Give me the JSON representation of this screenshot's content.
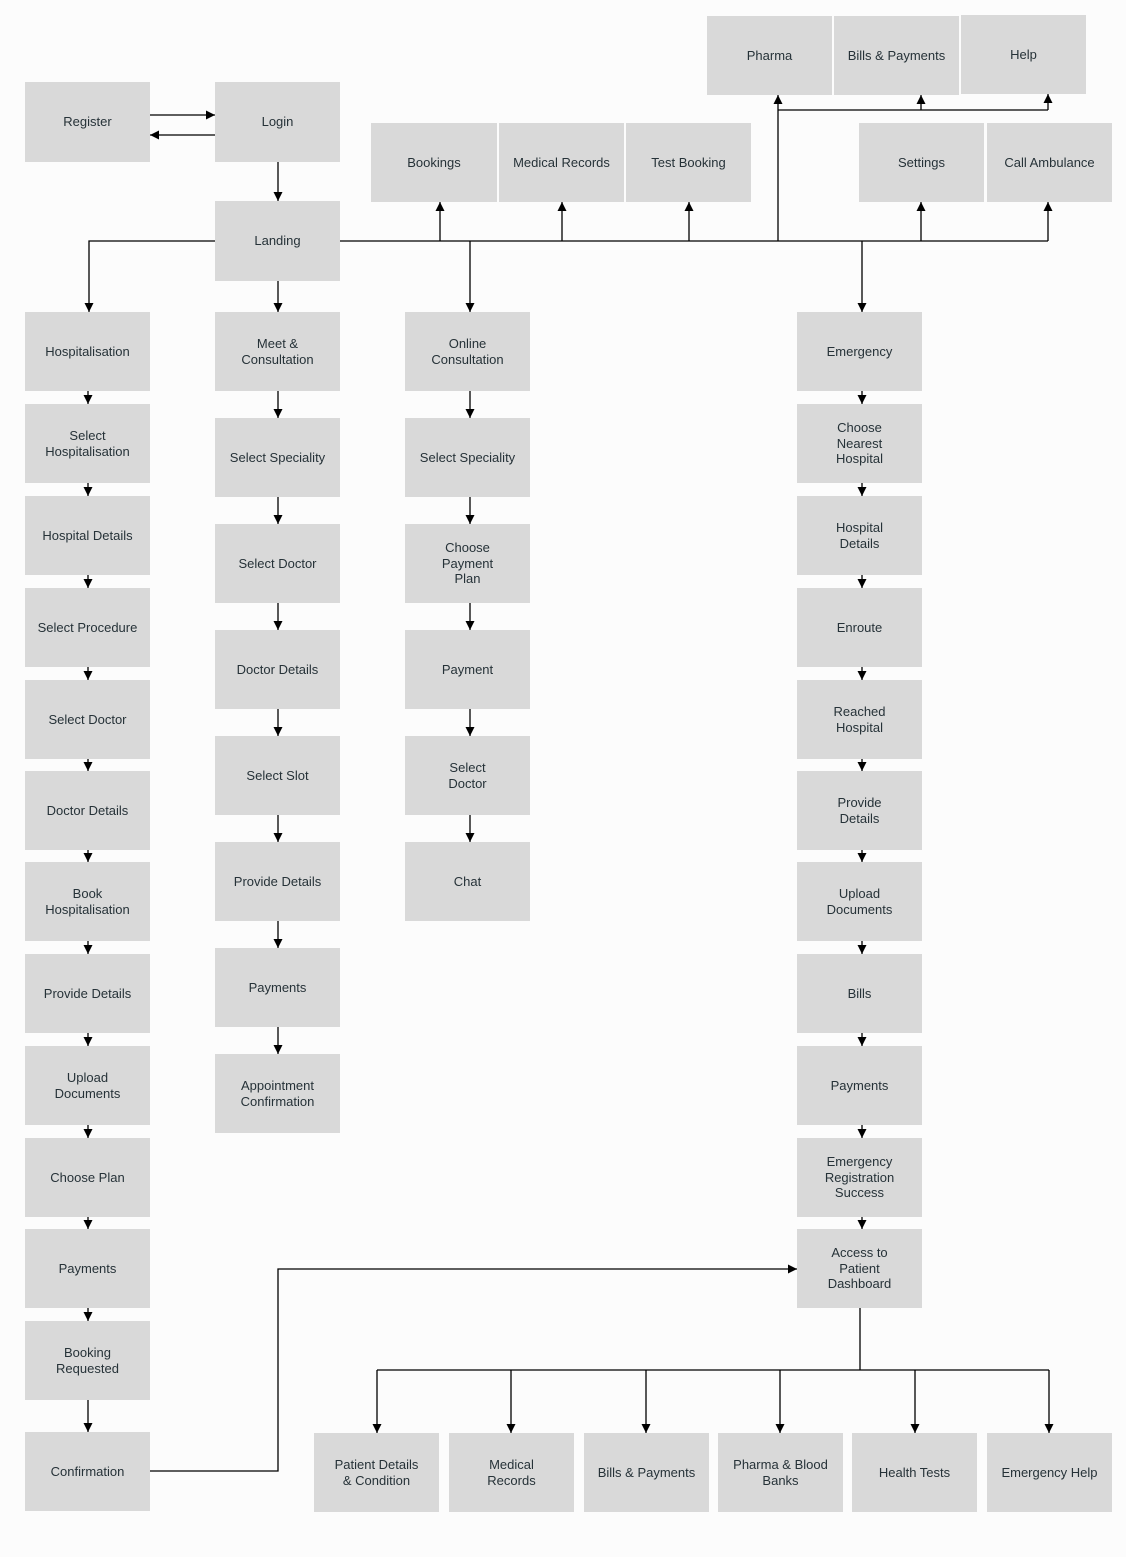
{
  "colors": {
    "background": "#fcfcfc",
    "node_fill": "#d9d9d9",
    "text": "#263238",
    "edge": "#000000"
  },
  "nodes": {
    "pharma": "Pharma",
    "bills_payments_top": "Bills & Payments",
    "help": "Help",
    "register": "Register",
    "login": "Login",
    "bookings": "Bookings",
    "medical_records_top": "Medical Records",
    "test_booking": "Test Booking",
    "settings": "Settings",
    "call_ambulance": "Call Ambulance",
    "landing": "Landing",
    "hospitalisation": [
      "Hospitalisation",
      "Select\nHospitalisation",
      "Hospital Details",
      "Select Procedure",
      "Select Doctor",
      "Doctor Details",
      "Book\nHospitalisation",
      "Provide Details",
      "Upload\nDocuments",
      "Choose Plan",
      "Payments",
      "Booking\nRequested",
      "Confirmation"
    ],
    "meet": [
      "Meet &\nConsultation",
      "Select Speciality",
      "Select Doctor",
      "Doctor Details",
      "Select Slot",
      "Provide Details",
      "Payments",
      "Appointment\nConfirmation"
    ],
    "online": [
      "Online\nConsultation",
      "Select Speciality",
      "Choose\nPayment\nPlan",
      "Payment",
      "Select\nDoctor",
      "Chat"
    ],
    "emergency": [
      "Emergency",
      "Choose\nNearest\nHospital",
      "Hospital\nDetails",
      "Enroute",
      "Reached\nHospital",
      "Provide\nDetails",
      "Upload\nDocuments",
      "Bills",
      "Payments",
      "Emergency\nRegistration\nSuccess",
      "Access to\nPatient\nDashboard"
    ],
    "dashboard": [
      "Patient Details\n& Condition",
      "Medical\nRecords",
      "Bills & Payments",
      "Pharma & Blood\nBanks",
      "Health Tests",
      "Emergency Help"
    ]
  }
}
